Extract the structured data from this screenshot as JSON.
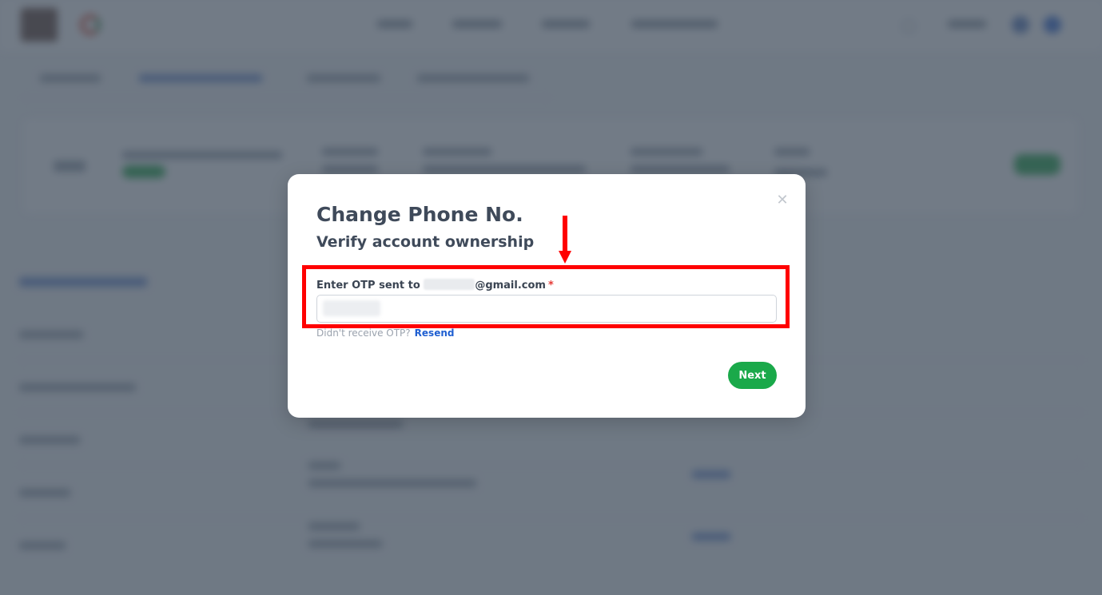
{
  "modal": {
    "title": "Change Phone No.",
    "subtitle": "Verify account ownership",
    "close_icon": "close-icon",
    "otp_label_prefix": "Enter OTP sent to ",
    "otp_label_email_suffix": "@gmail.com",
    "required_mark": "*",
    "otp_value": "",
    "resend_prompt": "Didn't receive OTP?",
    "resend_label": "Resend",
    "next_label": "Next"
  },
  "colors": {
    "primary_green": "#1aa94a",
    "link_blue": "#1f5fd1",
    "annotation_red": "#ff0000",
    "overlay": "rgba(60, 72, 88, 0.72)"
  },
  "annotations": {
    "highlight": "red-box-around-otp-field",
    "arrow": "red-down-arrow-icon"
  }
}
